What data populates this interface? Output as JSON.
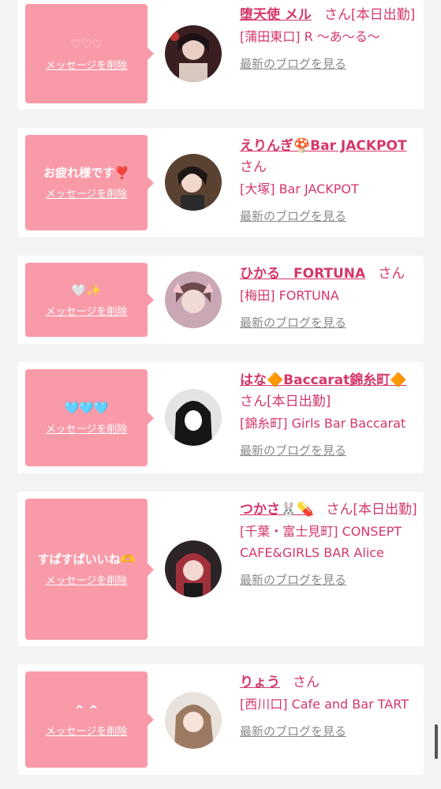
{
  "delete_label": "メッセージを削除",
  "blog_label": "最新のブログを見る",
  "cards": [
    {
      "message": "♡♡♡",
      "name": "堕天使 メル",
      "suffix": "さん[本日出勤]",
      "shop": "[蒲田東口] R 〜あ〜る〜"
    },
    {
      "message": "お疲れ様です❣️",
      "name": "えりんぎ🍄Bar JACKPOT",
      "suffix": "さん",
      "shop": "[大塚] Bar JACKPOT"
    },
    {
      "message": "🤍✨",
      "name": "ひかる　FORTUNA",
      "suffix": "さん",
      "shop": "[梅田] FORTUNA"
    },
    {
      "message": "🩵🩵🩵",
      "name": "はな🔶Baccarat錦糸町🔶",
      "suffix": "さん[本日出勤]",
      "shop": "[錦糸町] Girls Bar Baccarat"
    },
    {
      "message": "すぱすぱいいね🫶",
      "name": "つかさ🐰💊",
      "suffix": "さん[本日出勤]",
      "shop": "[千葉・富士見町] CONSEPT CAFE&GIRLS BAR Alice"
    },
    {
      "message": "^ ^",
      "name": "りょう",
      "suffix": "さん",
      "shop": "[西川口] Cafe and Bar TART"
    }
  ]
}
